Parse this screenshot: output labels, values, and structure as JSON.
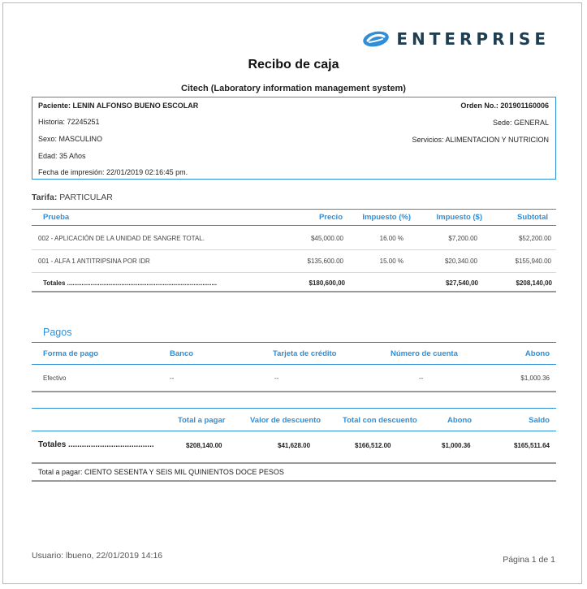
{
  "brand": {
    "name": "ENTERPRISE",
    "color": "#2e8ed8",
    "logo_icon": "enterprise-swoosh-logo"
  },
  "document": {
    "title": "Recibo de caja",
    "subtitle": "Citech (Laboratory information management system)"
  },
  "patient": {
    "paciente_label": "Paciente:",
    "paciente_value": "LENIN ALFONSO BUENO ESCOLAR",
    "historia": "Historia: 72245251",
    "sexo": "Sexo: MASCULINO",
    "edad": "Edad: 35 Años",
    "fecha": "Fecha de impresión: 22/01/2019 02:16:45 pm.",
    "orden_label": "Orden No.:",
    "orden_value": "201901160006",
    "sede": "Sede: GENERAL",
    "servicios": "Servicios: ALIMENTACION Y NUTRICION"
  },
  "tarifa": {
    "label": "Tarifa:",
    "value": "PARTICULAR"
  },
  "tests_table": {
    "headers": [
      "Prueba",
      "Precio",
      "Impuesto (%)",
      "Impuesto ($)",
      "Subtotal"
    ],
    "rows": [
      [
        "002 - APLICACIÓN DE LA UNIDAD DE SANGRE TOTAL.",
        "$45,000.00",
        "16.00 %",
        "$7,200.00",
        "$52,200.00"
      ],
      [
        "001 - ALFA 1 ANTITRIPSINA POR IDR",
        "$135,600.00",
        "15.00 %",
        "$20,340.00",
        "$155,940.00"
      ]
    ],
    "totals_label": "Totales ...................................................................................",
    "totals": {
      "precio": "$180,600,00",
      "impuesto": "$27,540,00",
      "subtotal": "$208,140,00"
    }
  },
  "payments": {
    "title": "Pagos",
    "headers": [
      "Forma de pago",
      "Banco",
      "Tarjeta de crédito",
      "Número de cuenta",
      "Abono"
    ],
    "rows": [
      [
        "Efectivo",
        "--",
        "--",
        "--",
        "$1,000.36"
      ]
    ]
  },
  "summary": {
    "headers": [
      "Total a pagar",
      "Valor de descuento",
      "Total con descuento",
      "Abono",
      "Saldo"
    ],
    "label": "Totales ......................................",
    "values": [
      "$208,140.00",
      "$41,628.00",
      "$166,512.00",
      "$1,000.36",
      "$165,511.64"
    ]
  },
  "total_letras": "Total a pagar: CIENTO SESENTA Y SEIS MIL QUINIENTOS DOCE PESOS",
  "footer": {
    "usuario": "Usuario: lbueno, 22/01/2019 14:16",
    "pagina": "Página 1 de 1"
  }
}
